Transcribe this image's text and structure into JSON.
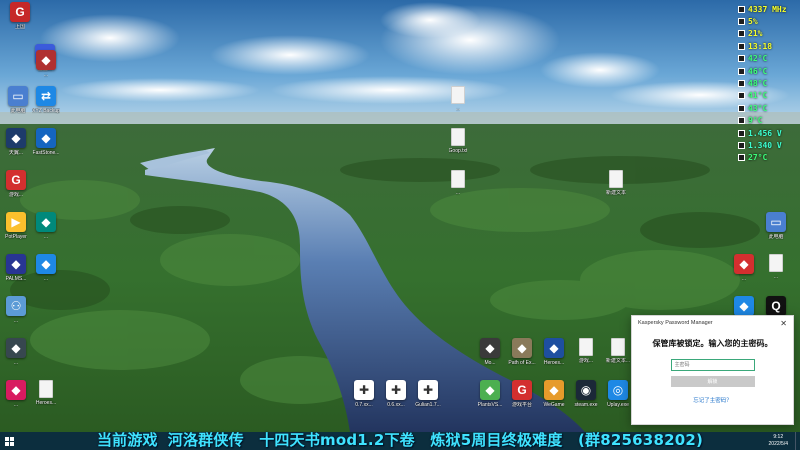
{
  "monitor": [
    {
      "value": "4337 MHz",
      "color": "#f5ff2a"
    },
    {
      "value": "5%",
      "color": "#f5ff2a"
    },
    {
      "value": "21%",
      "color": "#f5ff2a"
    },
    {
      "value": "13:18",
      "color": "#f5ff2a"
    },
    {
      "value": "42°C",
      "color": "#3cff7a"
    },
    {
      "value": "46°C",
      "color": "#3cff7a"
    },
    {
      "value": "48°C",
      "color": "#3cff7a"
    },
    {
      "value": "41°C",
      "color": "#3cff7a"
    },
    {
      "value": "43°C",
      "color": "#3cff7a"
    },
    {
      "value": "9°C",
      "color": "#3cff7a"
    },
    {
      "value": "1.456 V",
      "color": "#3cffd0"
    },
    {
      "value": "1.340 V",
      "color": "#3cffd0"
    },
    {
      "value": "27°C",
      "color": "#3cff7a"
    }
  ],
  "icons": {
    "left": [
      {
        "label": "上国",
        "icon": "game-icon",
        "color": "#c62828"
      },
      {
        "label": "星空...",
        "icon": "app-icon",
        "color": "#3b5bdb"
      },
      {
        "label": "...",
        "icon": "app-icon",
        "color": "#b03030"
      },
      {
        "label": "此电脑",
        "icon": "computer-icon",
        "color": "#4a7fd0"
      },
      {
        "label": "XYZ Backup",
        "icon": "backup-icon",
        "color": "#1e88e5"
      },
      {
        "label": "天翼...",
        "icon": "app-icon",
        "color": "#1d3b6b"
      },
      {
        "label": "FastStone...",
        "icon": "app-icon",
        "color": "#1565c0"
      },
      {
        "label": "游戏...",
        "icon": "game-icon",
        "color": "#d32f2f"
      },
      {
        "label": "PotPlayer",
        "icon": "player-icon",
        "color": "#fbc02d"
      },
      {
        "label": "...",
        "icon": "app-icon",
        "color": "#00897b"
      },
      {
        "label": "PALMS...",
        "icon": "app-icon",
        "color": "#283593"
      },
      {
        "label": "...",
        "icon": "app-icon",
        "color": "#1e88e5"
      },
      {
        "label": "...",
        "icon": "network-icon",
        "color": "#5c9bd6"
      },
      {
        "label": "...",
        "icon": "app-icon",
        "color": "#37474f"
      },
      {
        "label": "...",
        "icon": "app-icon",
        "color": "#d81b60"
      },
      {
        "label": "Heroes...",
        "icon": "doc-icon",
        "color": "#f4f4f4"
      }
    ],
    "middle": [
      {
        "label": "...",
        "icon": "doc-icon"
      },
      {
        "label": "Goop.txt",
        "icon": "doc-icon"
      },
      {
        "label": "...",
        "icon": "doc-icon"
      },
      {
        "label": "新建文本",
        "icon": "doc-icon"
      }
    ],
    "bottom": [
      {
        "label": "Mo...",
        "icon": "app-icon",
        "color": "#3a3a3a"
      },
      {
        "label": "Path of Ex...",
        "icon": "app-icon",
        "color": "#8a7a5a"
      },
      {
        "label": "Heroes...",
        "icon": "app-icon",
        "color": "#1e4fa0"
      },
      {
        "label": "游戏...",
        "icon": "doc-icon"
      },
      {
        "label": "新建文本...",
        "icon": "doc-icon"
      },
      {
        "label": "0.7.xx...",
        "icon": "gamepad-icon",
        "color": "#ffffff"
      },
      {
        "label": "0.6.xx...",
        "icon": "gamepad-icon",
        "color": "#ffffff"
      },
      {
        "label": "Gulian1.7...",
        "icon": "gamepad-icon",
        "color": "#ffffff"
      },
      {
        "label": "PlantsVS...",
        "icon": "app-icon",
        "color": "#4caf50"
      },
      {
        "label": "游戏平台",
        "icon": "game-icon",
        "color": "#d32f2f"
      },
      {
        "label": "WeGame",
        "icon": "app-icon",
        "color": "#e69b2b"
      },
      {
        "label": "steam.exe",
        "icon": "steam-icon",
        "color": "#1b2838"
      },
      {
        "label": "Uplay.exe",
        "icon": "uplay-icon",
        "color": "#1e88e5"
      }
    ],
    "right": [
      {
        "label": "此电脑",
        "icon": "computer-icon",
        "color": "#4a7fd0"
      },
      {
        "label": "...",
        "icon": "app-icon",
        "color": "#d32f2f"
      },
      {
        "label": "...",
        "icon": "doc-icon"
      },
      {
        "label": "...",
        "icon": "app-icon",
        "color": "#1e88e5"
      },
      {
        "label": "...",
        "icon": "qq-icon",
        "color": "#111111"
      }
    ]
  },
  "kaspersky": {
    "app_name": "Kaspersky Password Manager",
    "message": "保管库被锁定。输入您的主密码。",
    "password_placeholder": "主密码",
    "unlock_button": "解锁",
    "forgot_link": "忘记了主密码？"
  },
  "taskbar": {
    "time": "9:12",
    "date": "2022/5/4"
  },
  "marquee": {
    "label": "当前游戏",
    "game": "河洛群侠传",
    "mod": "十四天书mod1.2下卷",
    "mode": "炼狱5周目终极难度",
    "group": "(群825638202)"
  }
}
